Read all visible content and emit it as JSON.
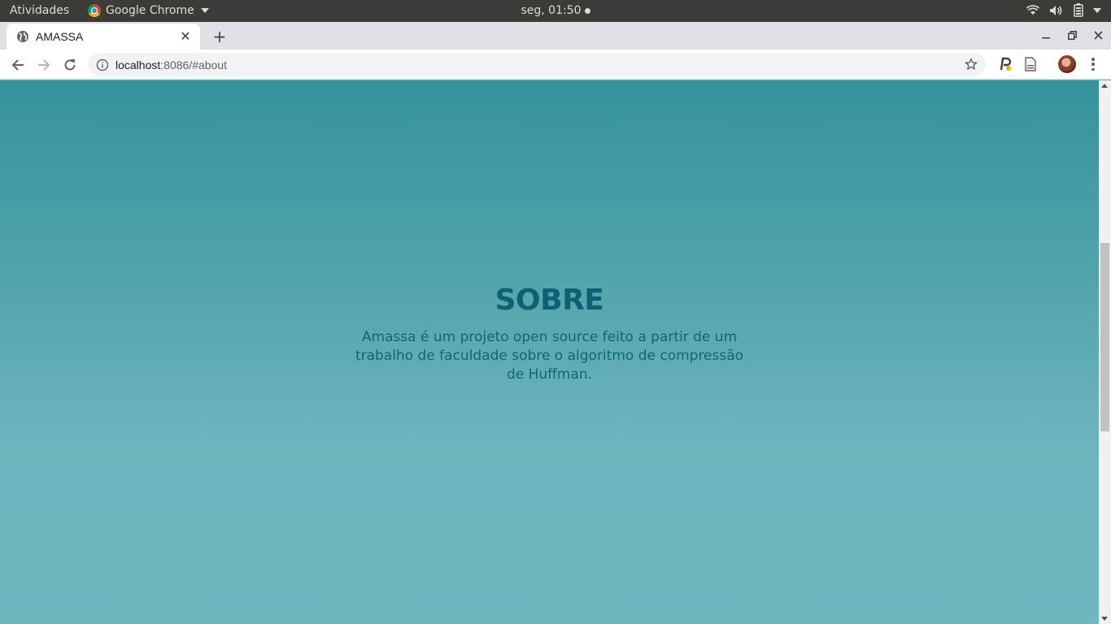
{
  "os_bar": {
    "activities": "Atividades",
    "app_name": "Google Chrome",
    "clock": "seg, 01:50"
  },
  "browser": {
    "tab_title": "AMASSA",
    "new_tab": "+",
    "url_host": "localhost",
    "url_rest": ":8086/#about"
  },
  "about": {
    "heading": "SOBRE",
    "text": "Amassa é um projeto open source feito a partir de um trabalho de faculdade sobre o algoritmo de compressão de Huffman."
  },
  "colors": {
    "heading": "#0c6273",
    "gradient_top": "#35929b",
    "gradient_bottom": "#6cb9be"
  }
}
